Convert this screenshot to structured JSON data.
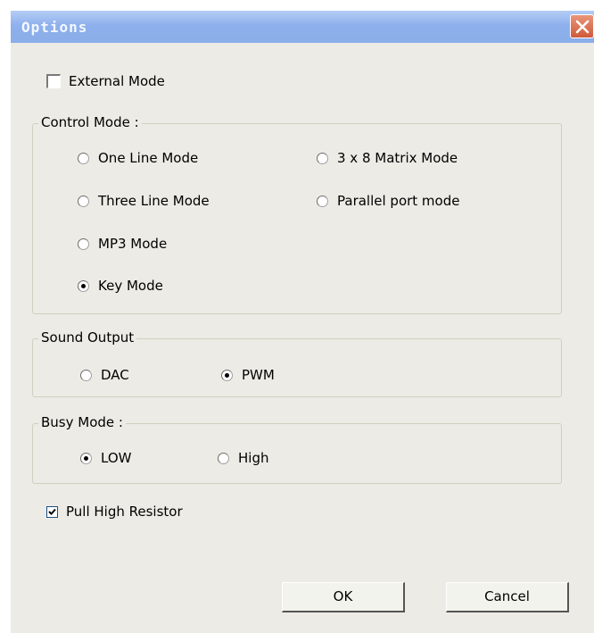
{
  "window": {
    "title": "Options"
  },
  "external_mode": {
    "label": "External Mode",
    "checked": false
  },
  "control_mode": {
    "legend": "Control Mode :",
    "options": [
      {
        "label": "One Line Mode",
        "selected": false
      },
      {
        "label": "3 x 8 Matrix Mode",
        "selected": false
      },
      {
        "label": "Three Line Mode",
        "selected": false
      },
      {
        "label": "Parallel port mode",
        "selected": false
      },
      {
        "label": "MP3 Mode",
        "selected": false
      },
      {
        "label": "Key Mode",
        "selected": true
      }
    ]
  },
  "sound_output": {
    "legend": "Sound Output",
    "options": [
      {
        "label": "DAC",
        "selected": false
      },
      {
        "label": "PWM",
        "selected": true
      }
    ]
  },
  "busy_mode": {
    "legend": "Busy Mode :",
    "options": [
      {
        "label": "LOW",
        "selected": true
      },
      {
        "label": "High",
        "selected": false
      }
    ]
  },
  "pull_high_resistor": {
    "label": "Pull High Resistor",
    "checked": true
  },
  "buttons": {
    "ok": "OK",
    "cancel": "Cancel"
  }
}
